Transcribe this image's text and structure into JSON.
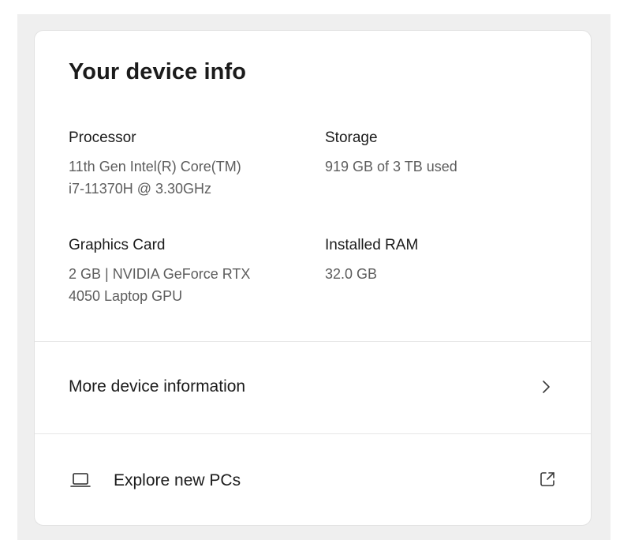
{
  "card": {
    "title": "Your device info"
  },
  "specs": {
    "processor": {
      "label": "Processor",
      "value_line1": "11th Gen Intel(R) Core(TM)",
      "value_line2": "i7-11370H @ 3.30GHz"
    },
    "storage": {
      "label": "Storage",
      "value": "919 GB of 3 TB used"
    },
    "graphics": {
      "label": "Graphics Card",
      "value_line1": "2 GB | NVIDIA GeForce RTX",
      "value_line2": "4050 Laptop GPU"
    },
    "ram": {
      "label": "Installed RAM",
      "value": "32.0 GB"
    }
  },
  "rows": {
    "more_info": {
      "label": "More device information",
      "icon": "chevron-right-icon"
    },
    "explore": {
      "label": "Explore new PCs",
      "leading_icon": "laptop-icon",
      "trailing_icon": "external-link-icon"
    }
  },
  "colors": {
    "background": "#efefef",
    "card": "#ffffff",
    "text_primary": "#1b1b1b",
    "text_secondary": "#5d5d5d",
    "divider": "#e6e6e6"
  }
}
